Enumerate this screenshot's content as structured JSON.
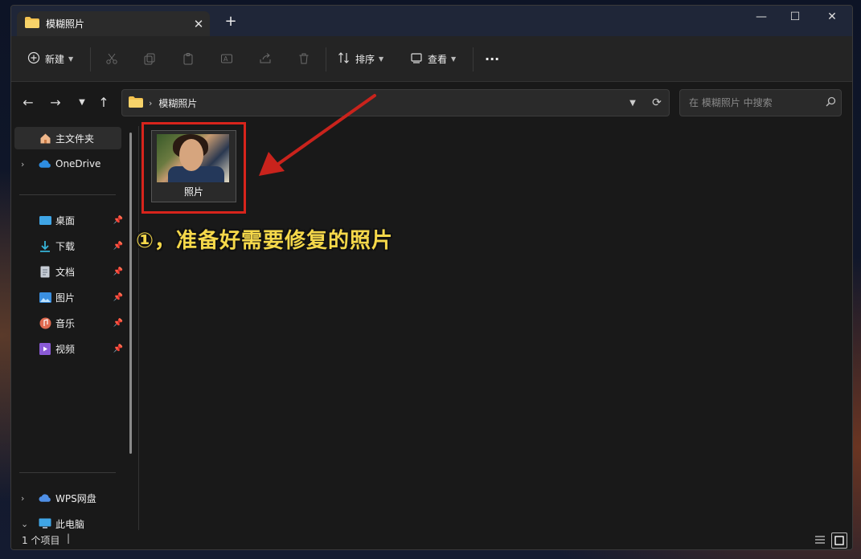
{
  "tab": {
    "title": "模糊照片",
    "close": "✕",
    "new": "+"
  },
  "window_controls": {
    "minimize": "—",
    "maximize": "☐",
    "close": "✕"
  },
  "toolbar": {
    "new_label": "新建",
    "sort_label": "排序",
    "view_label": "查看",
    "more": "···",
    "icons": [
      "cut-icon",
      "copy-icon",
      "paste-icon",
      "rename-icon",
      "share-icon",
      "delete-icon"
    ]
  },
  "address": {
    "crumb": "模糊照片",
    "search_placeholder": "在 模糊照片 中搜索"
  },
  "sidebar": {
    "home": "主文件夹",
    "onedrive": "OneDrive",
    "quick": [
      {
        "label": "桌面",
        "icon": "desktop-icon",
        "color": "#3fa5e6"
      },
      {
        "label": "下载",
        "icon": "download-icon",
        "color": "#36b3d8"
      },
      {
        "label": "文档",
        "icon": "document-icon",
        "color": "#9aa4b2"
      },
      {
        "label": "图片",
        "icon": "pictures-icon",
        "color": "#3a8fe0"
      },
      {
        "label": "音乐",
        "icon": "music-icon",
        "color": "#e06a50"
      },
      {
        "label": "视频",
        "icon": "video-icon",
        "color": "#8a5ad6"
      }
    ],
    "wps": "WPS网盘",
    "thispc": "此电脑"
  },
  "files": [
    {
      "name": "照片",
      "type": "image"
    }
  ],
  "annotation": "①，准备好需要修复的照片",
  "status": {
    "count": "1 个项目",
    "caret": "|"
  },
  "colors": {
    "accent_red": "#d8241c",
    "annotation_yellow": "#f5d84a",
    "folder": "#f2c14e"
  }
}
